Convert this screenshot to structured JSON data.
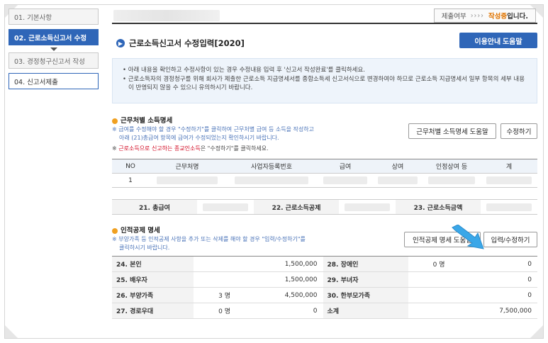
{
  "sidebar": {
    "steps": [
      {
        "label": "01. 기본사항"
      },
      {
        "label": "02. 근로소득신고서 수정"
      },
      {
        "label": "03. 경정청구신고서 작성"
      },
      {
        "label": "04. 신고서제출"
      }
    ]
  },
  "status": {
    "label": "제출여부",
    "arrows": "››››",
    "value": "작성중",
    "suffix": "입니다."
  },
  "page": {
    "title": "근로소득신고서 수정입력[2020]",
    "guide_button": "이용안내 도움말"
  },
  "info": {
    "line1": "• 아래 내용을 확인하고 수정사항이 있는 경우 수정내용 입력 후 '신고서 작성완료'를 클릭하세요.",
    "line2": "• 근로소득자의 경정청구를 위해 회사가 제출한 근로소득 지급명세서를 종합소득세 신고서식으로 변경하여야 하므로 근로소득 지급명세서 일부 항목의 세부 내용이 반영되지 않을 수 있으니 유의하시기 바랍니다."
  },
  "income": {
    "title": "근무처별 소득명세",
    "note1": "※ 급여를 수정해야 할 경우 \"수정하기\"를 클릭하여 근무처별 급여 등 소득을 작성하고",
    "note2": "아래 (21)총급여 항목에 급여가 수정되었는지 확인하시기 바랍니다.",
    "note3_prefix": "※ ",
    "note3_red": "근로소득으로 신고하는 종교인소득",
    "note3_suffix": "은 \"수정하기\"를 클릭하세요.",
    "help_button": "근무처별 소득명세 도움말",
    "edit_button": "수정하기",
    "columns": [
      "NO",
      "근무처명",
      "사업자등록번호",
      "급여",
      "상여",
      "인정상여 등",
      "계"
    ],
    "rows": [
      {
        "no": "1"
      }
    ]
  },
  "totals": {
    "total_pay": "21. 총급여",
    "income_deduction": "22. 근로소득공제",
    "income_amount": "23. 근로소득금액"
  },
  "deduction": {
    "title": "인적공제 명세",
    "note1": "※ 부양가족 등 인적공제 사항을 추가 또는 삭제를 해야 할 경우 \"입력/수정하기\"를",
    "note2": "클릭하시기 바랍니다.",
    "help_button": "인적공제 명세 도움말",
    "edit_button": "입력/수정하기",
    "rows": [
      {
        "l1": "24. 본인",
        "c1": "",
        "a1": "1,500,000",
        "l2": "28. 장애인",
        "c2": "0 명",
        "a2": "0"
      },
      {
        "l1": "25. 배우자",
        "c1": "",
        "a1": "1,500,000",
        "l2": "29. 부녀자",
        "c2": "",
        "a2": "0"
      },
      {
        "l1": "26. 부양가족",
        "c1": "3 명",
        "a1": "4,500,000",
        "l2": "30. 한부모가족",
        "c2": "",
        "a2": "0"
      },
      {
        "l1": "27. 경로우대",
        "c1": "0 명",
        "a1": "0",
        "l2": "소계",
        "c2": "",
        "a2": "7,500,000"
      }
    ]
  },
  "colors": {
    "primary": "#2f66b8",
    "status": "#e07400",
    "pointer": "#3aa7e8",
    "warning": "#d0021b"
  }
}
